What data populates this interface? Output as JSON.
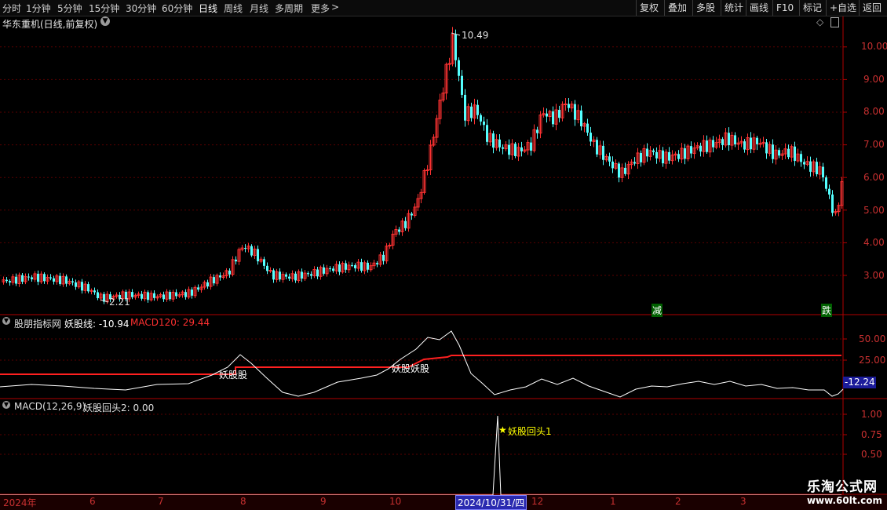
{
  "toolbar": {
    "periods": [
      "分时",
      "1分钟",
      "5分钟",
      "15分钟",
      "30分钟",
      "60分钟",
      "日线",
      "周线",
      "月线",
      "多周期",
      "更多"
    ],
    "active_period": "日线",
    "more_arrow": ">",
    "right_buttons": [
      "复权",
      "叠加",
      "多股",
      "统计",
      "画线",
      "F10",
      "标记",
      "+自选",
      "返回"
    ]
  },
  "main": {
    "title": "华东重机(日线,前复权)",
    "ticks": [
      "10.00",
      "9.00",
      "8.00",
      "7.00",
      "6.00",
      "5.00",
      "4.00",
      "3.00"
    ],
    "high_label": "10.49",
    "low_label": "2.21",
    "marker_jian": "减",
    "marker_die": "跌"
  },
  "ind1": {
    "name": "股朋指标网",
    "line_label": "妖股线: -10.94",
    "macd_label": "MACD120: 29.44",
    "ticks": [
      "50.00",
      "25.00"
    ],
    "current_value": "-12.24",
    "tag1": "妖股股",
    "tag2": "妖股妖股"
  },
  "ind2": {
    "name": "MACD(12,26,9)",
    "value_label": "妖股回头2: 0.00",
    "ticks": [
      "1.00",
      "0.75",
      "0.50"
    ],
    "annotation": "妖股回头1",
    "star": "★"
  },
  "datebar": {
    "labels": [
      "2024年",
      "6",
      "7",
      "8",
      "9",
      "10",
      "12",
      "1",
      "2",
      "3"
    ],
    "cursor_date": "2024/10/31/四"
  },
  "watermark": {
    "line1": "乐淘公式网",
    "line2": "www.60lt.com"
  },
  "colors": {
    "up": "#ff3232",
    "down": "#54ffff",
    "axis": "#b00000",
    "grid": "#5a0000",
    "white": "#ffffff",
    "yellow": "#ffff00"
  }
}
